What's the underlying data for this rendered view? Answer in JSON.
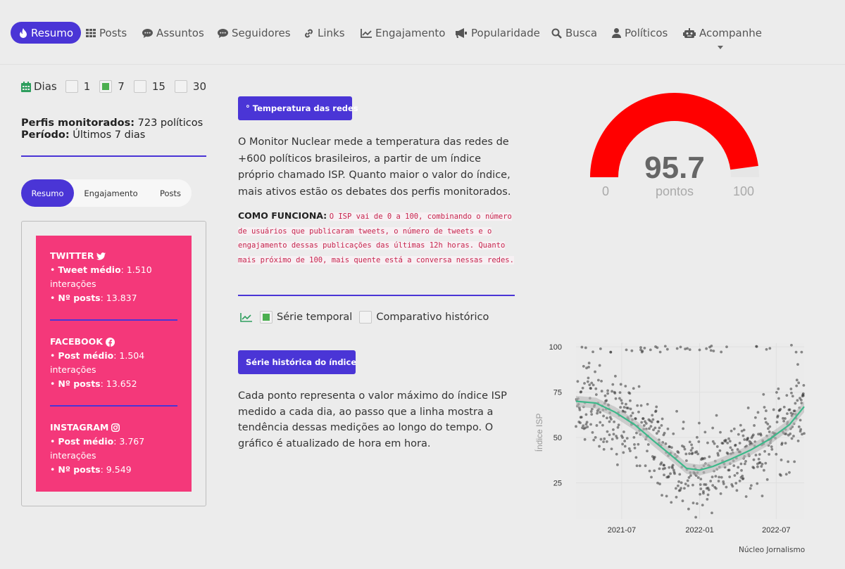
{
  "nav": {
    "items": [
      {
        "label": "Resumo",
        "icon": "fire-icon",
        "active": true
      },
      {
        "label": "Posts",
        "icon": "grid-icon"
      },
      {
        "label": "Assuntos",
        "icon": "comment-icon"
      },
      {
        "label": "Seguidores",
        "icon": "comment-icon"
      },
      {
        "label": "Links",
        "icon": "link-icon"
      },
      {
        "label": "Engajamento",
        "icon": "line-chart-icon"
      },
      {
        "label": "Popularidade",
        "icon": "megaphone-icon"
      },
      {
        "label": "Busca",
        "icon": "search-icon"
      },
      {
        "label": "Políticos",
        "icon": "user-icon"
      },
      {
        "label": "Acompanhe",
        "icon": "robot-icon"
      }
    ]
  },
  "days": {
    "label": "Dias",
    "options": [
      {
        "label": "1",
        "checked": false
      },
      {
        "label": "7",
        "checked": true
      },
      {
        "label": "15",
        "checked": false
      },
      {
        "label": "30",
        "checked": false
      }
    ]
  },
  "profiles": {
    "monitored_label": "Perfis monitorados:",
    "monitored_value": "723 políticos",
    "period_label": "Período:",
    "period_value": "Últimos 7 dias"
  },
  "tabs": [
    "Resumo",
    "Engajamento",
    "Posts"
  ],
  "networks": [
    {
      "name": "TWITTER",
      "icon": "twitter-icon",
      "metric_label": "Tweet médio",
      "metric_value": ": 1.510",
      "metric_unit": "interações",
      "posts_label": "Nº posts",
      "posts_value": ": 13.837"
    },
    {
      "name": "FACEBOOK",
      "icon": "facebook-icon",
      "metric_label": "Post médio",
      "metric_value": ": 1.504",
      "metric_unit": "interações",
      "posts_label": "Nº posts",
      "posts_value": ": 13.652"
    },
    {
      "name": "INSTAGRAM",
      "icon": "instagram-icon",
      "metric_label": "Post médio",
      "metric_value": ": 3.767",
      "metric_unit": "interações",
      "posts_label": "Nº posts",
      "posts_value": ": 9.549"
    }
  ],
  "temperature": {
    "badge": "° Temperatura das redes",
    "intro": "O Monitor Nuclear mede a temperatura das redes de +600 políticos brasileiros, a partir de um índice próprio chamado ISP. Quanto maior o valor do índice, mais ativos estão os debates dos perfis monitorados.",
    "how_label": "COMO FUNCIONA:",
    "how_text": "O ISP vai de 0 a 100, combinando o número de usuários que publicaram tweets, o número de tweets e o engajamento dessas publicações das últimas 12h horas. Quanto mais próximo de 100, mais quente está a conversa nessas redes."
  },
  "gauge": {
    "value": 95.7,
    "display": "95.7",
    "unit": "pontos",
    "min": "0",
    "max": "100",
    "min_value": 0,
    "max_value": 100,
    "color": "#ff0000",
    "track_color": "#e6e6e6"
  },
  "series_options": [
    {
      "label": "Série temporal",
      "checked": true
    },
    {
      "label": "Comparativo histórico",
      "checked": false
    }
  ],
  "history": {
    "badge": "Série histórica do índice",
    "text": "Cada ponto representa o valor máximo do índice ISP medido a cada dia, ao passo que a linha mostra a tendência dessas medições ao longo do tempo. O gráfico é atualizado de hora em hora."
  },
  "chart_data": {
    "type": "scatter",
    "title": "",
    "xlabel": "",
    "ylabel": "Índice ISP",
    "x_range": [
      "2021-03-15",
      "2022-09-05"
    ],
    "ylim": [
      5,
      102
    ],
    "x_ticks": [
      "2021-07",
      "2022-01",
      "2022-07"
    ],
    "y_ticks": [
      25,
      50,
      75,
      100
    ],
    "grid": true,
    "point_color": "#333333",
    "trend_color": "#3cb98a",
    "trend": [
      {
        "date": "2021-03-15",
        "y": 70
      },
      {
        "date": "2021-05-01",
        "y": 69
      },
      {
        "date": "2021-06-15",
        "y": 64
      },
      {
        "date": "2021-08-01",
        "y": 57
      },
      {
        "date": "2021-09-15",
        "y": 48
      },
      {
        "date": "2021-11-01",
        "y": 39
      },
      {
        "date": "2021-12-01",
        "y": 33
      },
      {
        "date": "2022-01-01",
        "y": 32
      },
      {
        "date": "2022-02-01",
        "y": 34
      },
      {
        "date": "2022-03-15",
        "y": 38
      },
      {
        "date": "2022-05-01",
        "y": 43
      },
      {
        "date": "2022-06-15",
        "y": 49
      },
      {
        "date": "2022-08-01",
        "y": 57
      },
      {
        "date": "2022-09-05",
        "y": 67
      }
    ]
  },
  "credit": "Núcleo Jornalismo"
}
